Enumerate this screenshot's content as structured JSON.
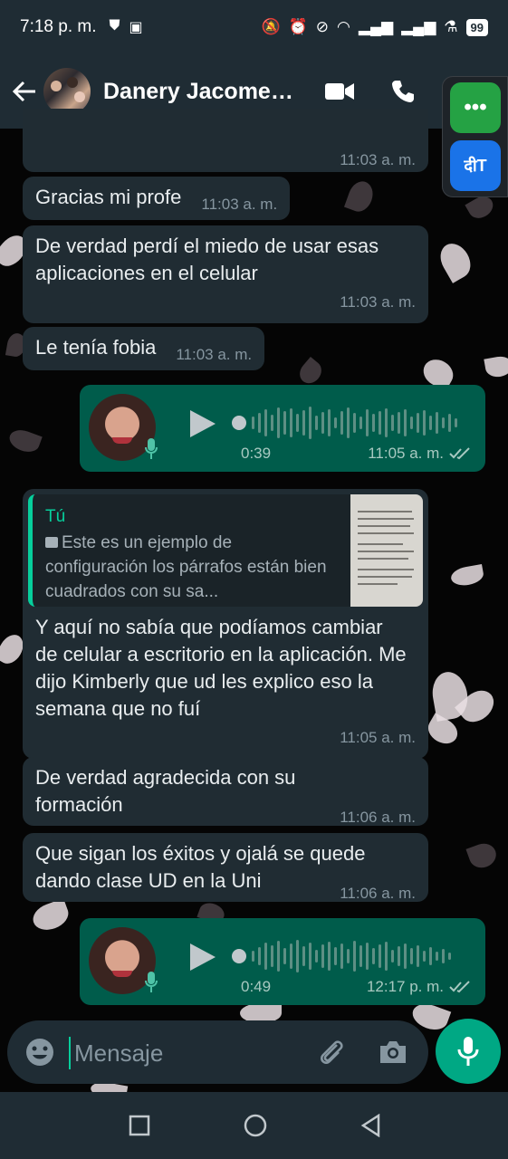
{
  "status_bar": {
    "time": "7:18 p. m.",
    "battery": "99"
  },
  "header": {
    "title": "Danery Jacome Reyes",
    "back_icon": "arrow-left-icon",
    "video_icon": "video-camera-icon",
    "call_icon": "phone-icon"
  },
  "floating": {
    "green_label": "•••",
    "blue_label": "दीT"
  },
  "messages": {
    "m1": {
      "text": "",
      "time": "11:03 a. m."
    },
    "m2": {
      "text": "Gracias mi profe",
      "time": "11:03 a. m."
    },
    "m3": {
      "text": "De verdad perdí el miedo de usar esas aplicaciones en el celular",
      "time": "11:03 a. m."
    },
    "m4": {
      "text": "Le tenía fobia",
      "time": "11:03 a. m."
    },
    "voice1": {
      "duration": "0:39",
      "time": "11:05 a. m."
    },
    "m5": {
      "quote_author": "Tú",
      "quote_text": "Este es un ejemplo de configuración los párrafos están bien cuadrados con su sa...",
      "text": "Y aquí no sabía que podíamos cambiar de celular a escritorio en la aplicación. Me dijo Kimberly que ud les explico eso la semana que no fuí",
      "time": "11:05 a. m."
    },
    "m6": {
      "text": "De verdad agradecida con su formación",
      "time": "11:06 a. m."
    },
    "m7": {
      "text": "Que sigan los éxitos y ojalá se quede dando clase UD en la Uni",
      "time": "11:06 a. m."
    },
    "voice2": {
      "duration": "0:49",
      "time": "12:17 p. m."
    }
  },
  "input": {
    "placeholder": "Mensaje"
  },
  "colors": {
    "bar_bg": "#1f2c34",
    "incoming": "#202c33",
    "outgoing": "#005c4b",
    "accent": "#00a884"
  }
}
